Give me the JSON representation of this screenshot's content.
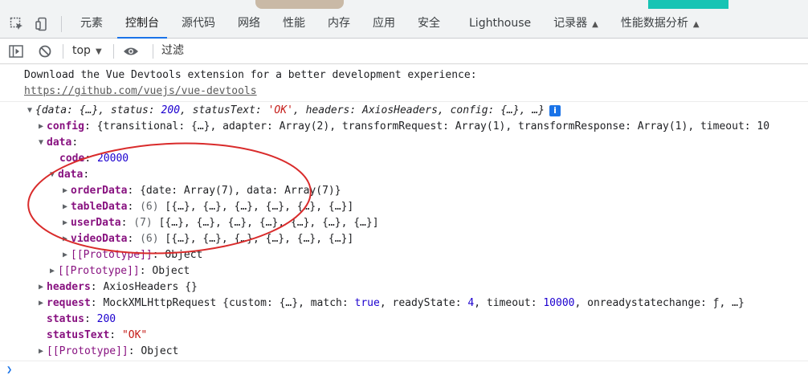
{
  "tabs": [
    {
      "label": "元素",
      "active": false
    },
    {
      "label": "控制台",
      "active": true
    },
    {
      "label": "源代码",
      "active": false
    },
    {
      "label": "网络",
      "active": false
    },
    {
      "label": "性能",
      "active": false
    },
    {
      "label": "内存",
      "active": false
    },
    {
      "label": "应用",
      "active": false
    },
    {
      "label": "安全",
      "active": false
    },
    {
      "label": "Lighthouse",
      "active": false
    },
    {
      "label": "记录器",
      "active": false,
      "flask": true
    },
    {
      "label": "性能数据分析",
      "active": false,
      "flask": true
    }
  ],
  "toolbar": {
    "context": "top",
    "filter_placeholder": "过滤"
  },
  "console": {
    "vue_msg": "Download the Vue Devtools extension for a better development experience:",
    "vue_link": "https://github.com/vuejs/vue-devtools",
    "summary": {
      "a": "{data: {…}, status: ",
      "status": "200",
      "b": ", statusText: ",
      "statusText": "'OK'",
      "c": ", headers: AxiosHeaders, config: {…}, …}"
    },
    "config": {
      "key": "config",
      "value": "{transitional: {…}, adapter: Array(2), transformRequest: Array(1), transformResponse: Array(1), timeout: 10"
    },
    "data_key": "data",
    "code": {
      "key": "code",
      "value": "20000"
    },
    "inner_data_key": "data",
    "orderData": {
      "key": "orderData",
      "value": "{date: Array(7), data: Array(7)}"
    },
    "tableData": {
      "key": "tableData",
      "count": "(6)",
      "value": "[{…}, {…}, {…}, {…}, {…}, {…}]"
    },
    "userData": {
      "key": "userData",
      "count": "(7)",
      "value": "[{…}, {…}, {…}, {…}, {…}, {…}, {…}]"
    },
    "videoData": {
      "key": "videoData",
      "count": "(6)",
      "value": "[{…}, {…}, {…}, {…}, {…}, {…}]"
    },
    "proto_inner": {
      "key": "[[Prototype]]",
      "value": "Object"
    },
    "proto_data": {
      "key": "[[Prototype]]",
      "value": "Object"
    },
    "headers": {
      "key": "headers",
      "value": "AxiosHeaders {}"
    },
    "request": {
      "key": "request",
      "a": "MockXMLHttpRequest {custom: {…}, match: ",
      "match": "true",
      "b": ", readyState: ",
      "readyState": "4",
      "c": ", timeout: ",
      "timeout": "10000",
      "d": ", onreadystatechange: ƒ, …}"
    },
    "status": {
      "key": "status",
      "value": "200"
    },
    "statusText": {
      "key": "statusText",
      "value": "\"OK\""
    },
    "proto_root": {
      "key": "[[Prototype]]",
      "value": "Object"
    }
  },
  "colors": {
    "accent": "#1a73e8",
    "annotation": "#d92b2b",
    "key": "#881280",
    "number": "#1c00cf",
    "string": "#c41a16"
  }
}
